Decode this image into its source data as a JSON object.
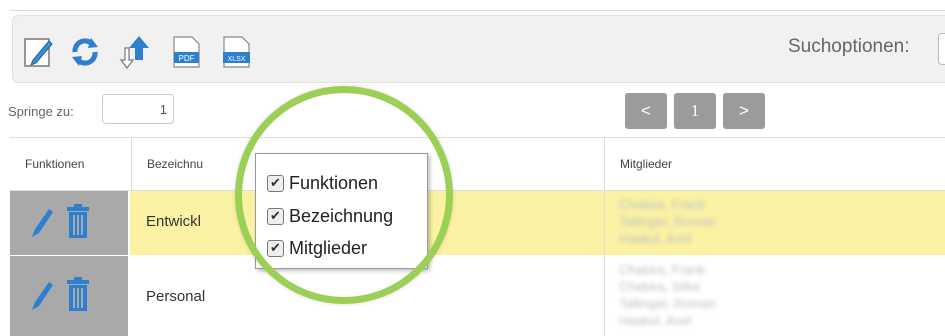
{
  "toolbar": {
    "icons": [
      "edit-icon",
      "refresh-icon",
      "export-icon",
      "pdf-icon",
      "xlsx-icon"
    ],
    "pdf_text": "PDF",
    "xlsx_text": "XLSX",
    "search_label": "Suchoptionen:"
  },
  "pagination": {
    "jump_label": "Springe zu:",
    "jump_value": "1",
    "prev": "<",
    "page": "1",
    "next": ">"
  },
  "table": {
    "headers": [
      "Funktionen",
      "Bezeichnu",
      "Mitglieder"
    ],
    "rows": [
      {
        "bezeichnung": "Entwickl",
        "mitglieder": [
          "Chabira, Frank",
          "Tallinger, Roman",
          "Haakul, Axel"
        ],
        "highlight_color": "#fbf2a4"
      },
      {
        "bezeichnung": "Personal",
        "mitglieder": [
          "Chabira, Frank",
          "Chabira, Silke",
          "Tallinger, Roman",
          "Haakul, Axel"
        ]
      }
    ]
  },
  "column_chooser": {
    "items": [
      {
        "label": "Funktionen",
        "checked": true
      },
      {
        "label": "Bezeichnung",
        "checked": true
      },
      {
        "label": "Mitglieder",
        "checked": true
      }
    ],
    "check_glyph": "✔"
  },
  "colors": {
    "accent_ring": "#9ccf55",
    "action_icon": "#2f7fd0",
    "row_highlight": "#fbf2a4"
  }
}
